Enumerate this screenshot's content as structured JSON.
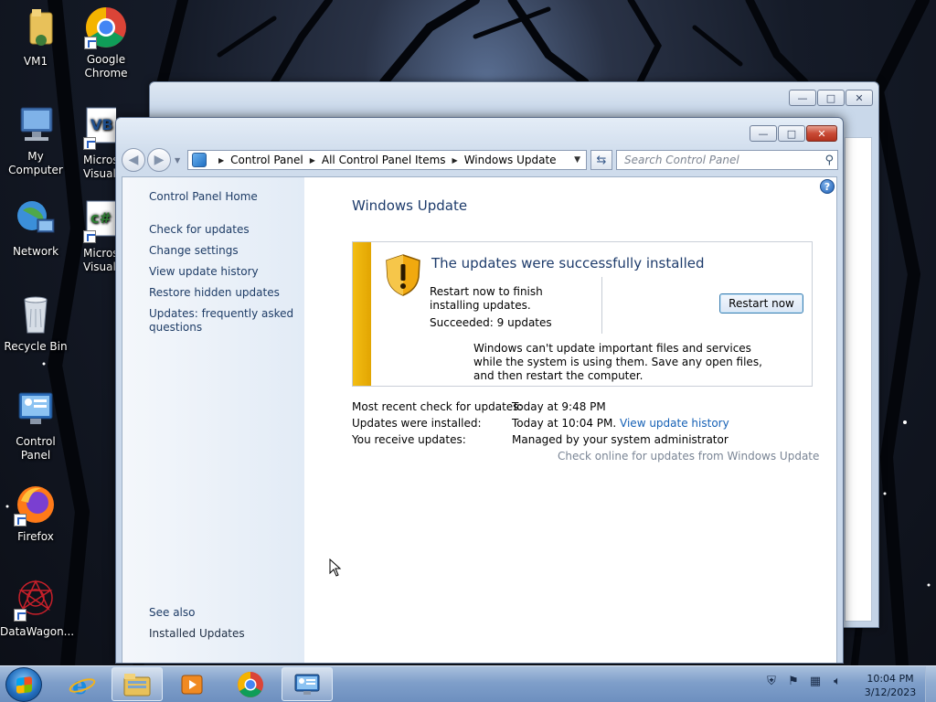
{
  "desktop": {
    "icons": [
      {
        "label": "VM1"
      },
      {
        "label": "Google Chrome"
      },
      {
        "label": "My Computer"
      },
      {
        "label": "Microsoft Visual B",
        "label_short": "Micros\nVisual B"
      },
      {
        "label": "Network"
      },
      {
        "label": "Microsoft Visual C#",
        "label_short": "Micros\nVisual C"
      },
      {
        "label": "Recycle Bin"
      },
      {
        "label": "Control Panel"
      },
      {
        "label": "Firefox"
      },
      {
        "label": "DataWagon..."
      }
    ]
  },
  "window": {
    "caption_buttons": {
      "minimize": "—",
      "maximize": "□",
      "close": "✕"
    },
    "breadcrumb": [
      "Control Panel",
      "All Control Panel Items",
      "Windows Update"
    ],
    "search_placeholder": "Search Control Panel",
    "left_pane": {
      "home": "Control Panel Home",
      "links": [
        "Check for updates",
        "Change settings",
        "View update history",
        "Restore hidden updates",
        "Updates: frequently asked questions"
      ],
      "see_also_label": "See also",
      "see_also_links": [
        "Installed Updates"
      ]
    },
    "main": {
      "title": "Windows Update",
      "status": {
        "title": "The updates were successfully installed",
        "message": "Restart now to finish installing updates.",
        "succeeded": "Succeeded: 9 updates",
        "button": "Restart now",
        "note": "Windows can't update important files and services while the system is using them. Save any open files, and then restart the computer.",
        "accent_color": "#f1b30c"
      },
      "info": [
        {
          "key": "Most recent check for updates:",
          "value": "Today at 9:48 PM"
        },
        {
          "key": "Updates were installed:",
          "value": "Today at 10:04 PM.",
          "link": "View update history"
        },
        {
          "key": "You receive updates:",
          "value": "Managed by your system administrator"
        }
      ],
      "check_online": "Check online for updates from Windows Update"
    }
  },
  "taskbar": {
    "items": [
      "start-orb",
      "internet-explorer-icon",
      "windows-explorer-icon",
      "media-player-icon",
      "chrome-icon",
      "control-panel-icon"
    ],
    "clock_time": "10:04 PM",
    "clock_date": "3/12/2023"
  }
}
